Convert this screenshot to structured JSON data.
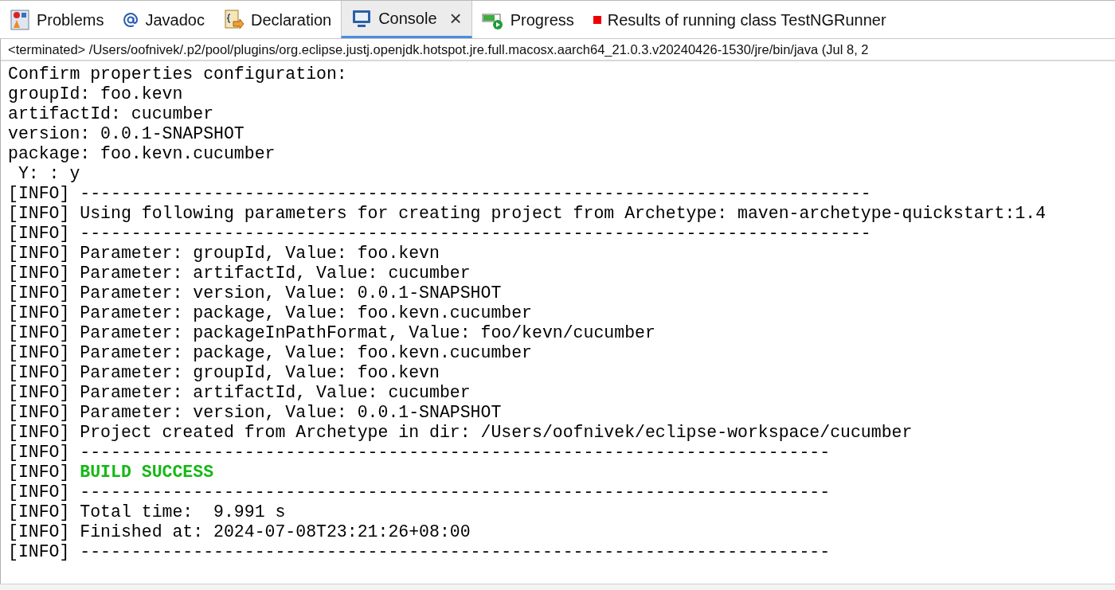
{
  "tabs": [
    {
      "label": "Problems",
      "selected": false
    },
    {
      "label": "Javadoc",
      "selected": false
    },
    {
      "label": "Declaration",
      "selected": false
    },
    {
      "label": "Console",
      "selected": true,
      "close_label": "×"
    },
    {
      "label": "Progress",
      "selected": false
    },
    {
      "label": "Results of running class TestNGRunner",
      "selected": false
    }
  ],
  "console": {
    "process_line": "<terminated> /Users/oofnivek/.p2/pool/plugins/org.eclipse.justj.openjdk.hotspot.jre.full.macosx.aarch64_21.0.3.v20240426-1530/jre/bin/java (Jul 8, 2",
    "lines": [
      {
        "kind": "plain",
        "text": "Confirm properties configuration:"
      },
      {
        "kind": "plain",
        "text": "groupId: foo.kevn"
      },
      {
        "kind": "plain",
        "text": "artifactId: cucumber"
      },
      {
        "kind": "plain",
        "text": "version: 0.0.1-SNAPSHOT"
      },
      {
        "kind": "plain",
        "text": "package: foo.kevn.cucumber"
      },
      {
        "kind": "plain",
        "text": " Y: : y"
      },
      {
        "kind": "plain",
        "text": "[INFO] -----------------------------------------------------------------------------"
      },
      {
        "kind": "plain",
        "text": "[INFO] Using following parameters for creating project from Archetype: maven-archetype-quickstart:1.4"
      },
      {
        "kind": "plain",
        "text": "[INFO] -----------------------------------------------------------------------------"
      },
      {
        "kind": "plain",
        "text": "[INFO] Parameter: groupId, Value: foo.kevn"
      },
      {
        "kind": "plain",
        "text": "[INFO] Parameter: artifactId, Value: cucumber"
      },
      {
        "kind": "plain",
        "text": "[INFO] Parameter: version, Value: 0.0.1-SNAPSHOT"
      },
      {
        "kind": "plain",
        "text": "[INFO] Parameter: package, Value: foo.kevn.cucumber"
      },
      {
        "kind": "plain",
        "text": "[INFO] Parameter: packageInPathFormat, Value: foo/kevn/cucumber"
      },
      {
        "kind": "plain",
        "text": "[INFO] Parameter: package, Value: foo.kevn.cucumber"
      },
      {
        "kind": "plain",
        "text": "[INFO] Parameter: groupId, Value: foo.kevn"
      },
      {
        "kind": "plain",
        "text": "[INFO] Parameter: artifactId, Value: cucumber"
      },
      {
        "kind": "plain",
        "text": "[INFO] Parameter: version, Value: 0.0.1-SNAPSHOT"
      },
      {
        "kind": "plain",
        "text": "[INFO] Project created from Archetype in dir: /Users/oofnivek/eclipse-workspace/cucumber"
      },
      {
        "kind": "plain",
        "text": "[INFO] -------------------------------------------------------------------------"
      },
      {
        "kind": "success",
        "prefix": "[INFO]",
        "text": "BUILD SUCCESS"
      },
      {
        "kind": "plain",
        "text": "[INFO] -------------------------------------------------------------------------"
      },
      {
        "kind": "plain",
        "text": "[INFO] Total time:  9.991 s"
      },
      {
        "kind": "plain",
        "text": "[INFO] Finished at: 2024-07-08T23:21:26+08:00"
      },
      {
        "kind": "plain",
        "text": "[INFO] -------------------------------------------------------------------------"
      }
    ]
  }
}
